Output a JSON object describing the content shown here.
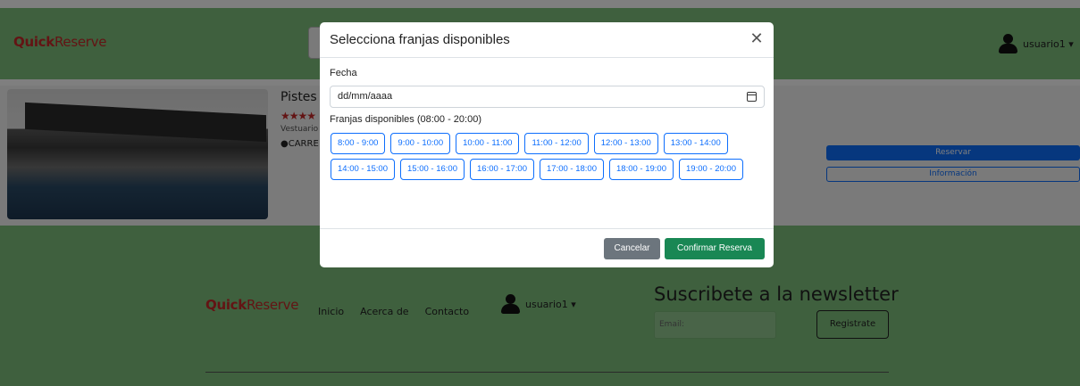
{
  "navbar": {
    "brand_bold": "Quick",
    "brand_light": "Reserve",
    "user_label": "usuario1 ▾"
  },
  "card": {
    "title": "Pistes d",
    "stars": "★★★★",
    "subtitle": "Vestuario",
    "location": "CARRE",
    "reserve_label": "Reservar",
    "info_label": "Información"
  },
  "footer": {
    "brand_bold": "Quick",
    "brand_light": "Reserve",
    "links": [
      "Inicio",
      "Acerca de",
      "Contacto"
    ],
    "user_label": "usuario1 ▾",
    "newsletter_title": "Suscribete a la newsletter",
    "email_placeholder": "Email:",
    "register_label": "Registrate"
  },
  "modal": {
    "title": "Selecciona franjas disponibles",
    "close_glyph": "✕",
    "date_label": "Fecha",
    "date_value": "dd/mm/aaaa",
    "slots_label": "Franjas disponibles (08:00 - 20:00)",
    "slots": [
      "8:00 - 9:00",
      "9:00 - 10:00",
      "10:00 - 11:00",
      "11:00 - 12:00",
      "12:00 - 13:00",
      "13:00 - 14:00",
      "14:00 - 15:00",
      "15:00 - 16:00",
      "16:00 - 17:00",
      "17:00 - 18:00",
      "18:00 - 19:00",
      "19:00 - 20:00"
    ],
    "cancel_label": "Cancelar",
    "confirm_label": "Confirmar Reserva"
  },
  "colors": {
    "navbar_green": "#7ec07d",
    "brand_red": "#c62828",
    "primary_blue": "#0d6efd",
    "confirm_green": "#198754",
    "cancel_gray": "#6c757d"
  }
}
